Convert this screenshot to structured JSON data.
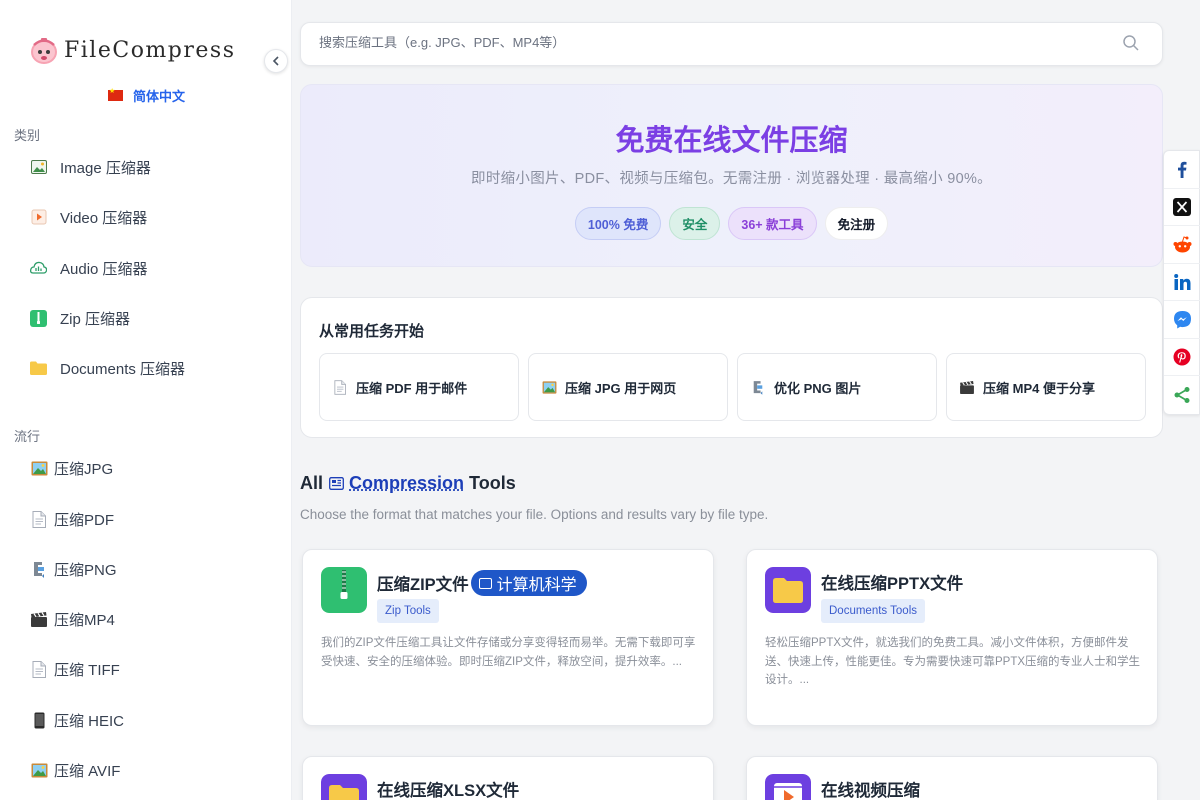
{
  "brand": {
    "name": "FileCompress"
  },
  "language": {
    "label": "简体中文"
  },
  "sidebar": {
    "categories_title": "类别",
    "categories": [
      {
        "label": "Image 压缩器",
        "icon": "image-icon"
      },
      {
        "label": "Video 压缩器",
        "icon": "video-icon"
      },
      {
        "label": "Audio 压缩器",
        "icon": "audio-icon"
      },
      {
        "label": "Zip 压缩器",
        "icon": "zip-icon"
      },
      {
        "label": "Documents 压缩器",
        "icon": "folder-icon"
      }
    ],
    "popular_title": "流行",
    "popular": [
      {
        "label": "压缩JPG",
        "icon": "picture-icon"
      },
      {
        "label": "压缩PDF",
        "icon": "document-icon"
      },
      {
        "label": "压缩PNG",
        "icon": "clamp-icon"
      },
      {
        "label": "压缩MP4",
        "icon": "clapper-icon"
      },
      {
        "label": "压缩 TIFF",
        "icon": "document-icon"
      },
      {
        "label": "压缩 HEIC",
        "icon": "phone-icon"
      },
      {
        "label": "压缩 AVIF",
        "icon": "picture-icon"
      }
    ]
  },
  "search": {
    "placeholder": "搜索压缩工具（e.g. JPG、PDF、MP4等）"
  },
  "hero": {
    "title": "免费在线文件压缩",
    "subtitle": "即时缩小图片、PDF、视频与压缩包。无需注册 · 浏览器处理 · 最高缩小 90%。",
    "pills": [
      "100% 免费",
      "安全",
      "36+ 款工具",
      "免注册"
    ]
  },
  "tasks": {
    "title": "从常用任务开始",
    "items": [
      {
        "label": "压缩 PDF 用于邮件",
        "icon": "document-icon"
      },
      {
        "label": "压缩 JPG 用于网页",
        "icon": "picture-icon"
      },
      {
        "label": "优化 PNG 图片",
        "icon": "clamp-icon"
      },
      {
        "label": "压缩 MP4 便于分享",
        "icon": "clapper-icon"
      }
    ]
  },
  "all_tools": {
    "prefix": "All",
    "link": "Compression",
    "suffix": "Tools",
    "subtitle": "Choose the format that matches your file. Options and results vary by file type."
  },
  "tools": [
    {
      "name": "压缩ZIP文件",
      "tag": "计算机科学",
      "badge": "Zip Tools",
      "desc": "我们的ZIP文件压缩工具让文件存储或分享变得轻而易举。无需下载即可享受快速、安全的压缩体验。即时压缩ZIP文件，释放空间，提升效率。..."
    },
    {
      "name": "在线压缩PPTX文件",
      "badge": "Documents Tools",
      "desc": "轻松压缩PPTX文件，就选我们的免费工具。减小文件体积，方便邮件发送、快速上传，性能更佳。专为需要快速可靠PPTX压缩的专业人士和学生设计。..."
    },
    {
      "name": "在线压缩XLSX文件"
    },
    {
      "name": "在线视频压缩"
    }
  ],
  "share": [
    "facebook-icon",
    "x-icon",
    "reddit-icon",
    "linkedin-icon",
    "messenger-icon",
    "pinterest-icon",
    "share-icon"
  ],
  "colors": {
    "accent": "#7b3fe4",
    "link": "#2563eb",
    "zip_green": "#2fbf71",
    "folder_yellow": "#f7c948"
  }
}
